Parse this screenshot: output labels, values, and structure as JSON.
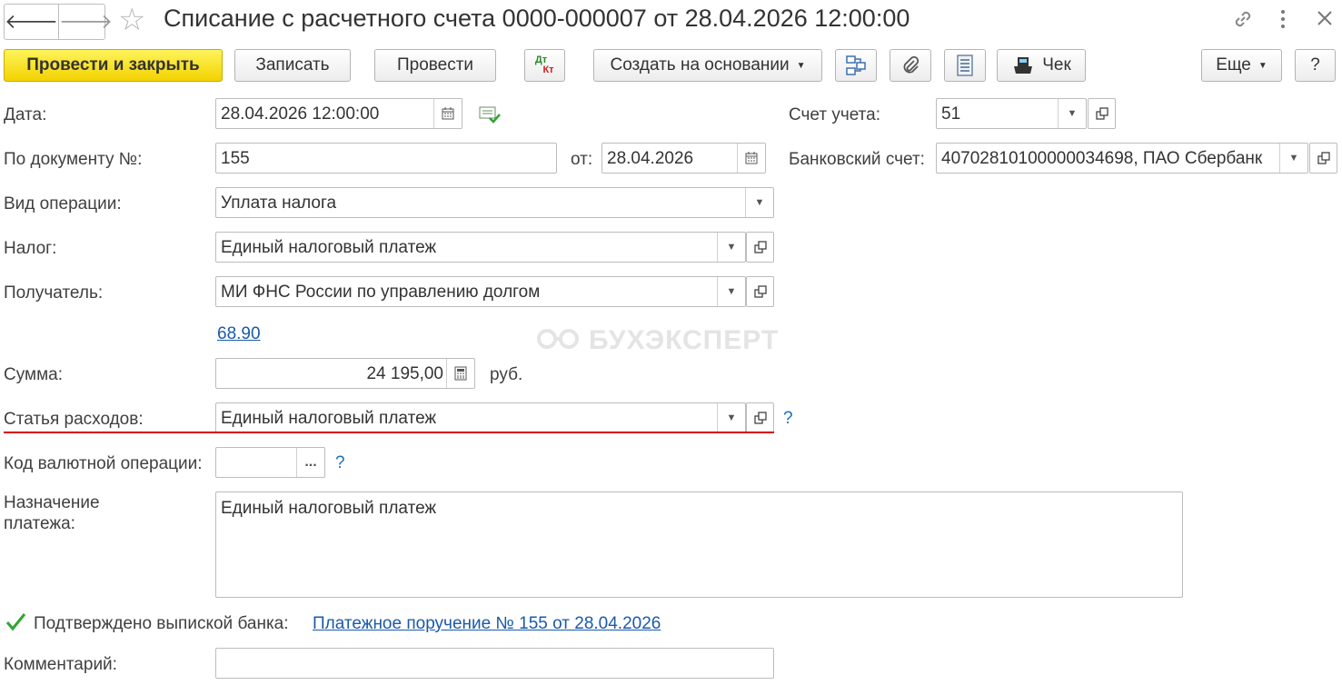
{
  "window": {
    "title": "Списание с расчетного счета 0000-000007 от 28.04.2026 12:00:00"
  },
  "nav": {
    "back_glyph": "🡐",
    "forward_glyph": "🡒",
    "star_glyph": "☆"
  },
  "toolbar": {
    "post_close": "Провести и закрыть",
    "save": "Записать",
    "post": "Провести",
    "dtkt_top": "Дт",
    "dtkt_bottom": "Кт",
    "create_basis": "Создать на основании",
    "cheque": "Чек",
    "more": "Еще",
    "help": "?"
  },
  "form": {
    "date_label": "Дата:",
    "date_value": "28.04.2026 12:00:00",
    "account_label": "Счет учета:",
    "account_value": "51",
    "doc_num_label": "По документу №:",
    "doc_num_value": "155",
    "doc_from_label": "от:",
    "doc_from_value": "28.04.2026",
    "bank_account_label": "Банковский счет:",
    "bank_account_value": "40702810100000034698, ПАО Сбербанк",
    "operation_label": "Вид операции:",
    "operation_value": "Уплата налога",
    "tax_label": "Налог:",
    "tax_value": "Единый налоговый платеж",
    "recipient_label": "Получатель:",
    "recipient_value": "МИ ФНС России по управлению долгом",
    "account_link": "68.90",
    "sum_label": "Сумма:",
    "sum_value": "24 195,00",
    "currency": "руб.",
    "expense_label": "Статья расходов:",
    "expense_value": "Единый налоговый платеж",
    "currency_op_label": "Код валютной операции:",
    "currency_op_value": "",
    "ellipsis": "...",
    "help_mark": "?",
    "purpose_label_1": "Назначение",
    "purpose_label_2": "платежа:",
    "purpose_value": "Единый налоговый платеж",
    "confirmed_label": "Подтверждено выпиской банка:",
    "confirmed_checked": true,
    "payment_order_link": "Платежное поручение № 155 от 28.04.2026",
    "comment_label": "Комментарий:",
    "comment_value": ""
  },
  "watermark": "БУХЭКСПЕРТ",
  "colors": {
    "primary_button": "#f7e227",
    "link": "#1a5aa8",
    "underline": "#d40000",
    "checkmark": "#2fa52f"
  }
}
